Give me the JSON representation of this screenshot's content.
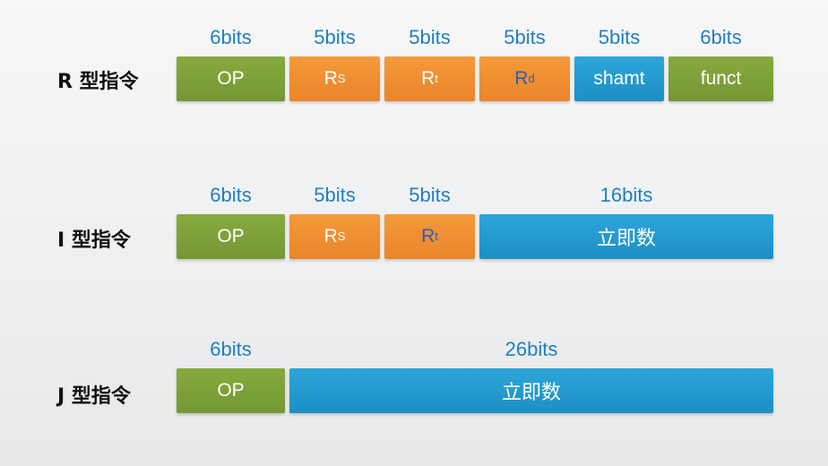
{
  "rows": [
    {
      "label": "R 型指令",
      "bits": [
        "6bits",
        "5bits",
        "5bits",
        "5bits",
        "5bits",
        "6bits"
      ],
      "fields": [
        {
          "main": "OP",
          "sub": ""
        },
        {
          "main": "R",
          "sub": "S"
        },
        {
          "main": "R",
          "sub": "t"
        },
        {
          "main": "R",
          "sub": "d"
        },
        {
          "main": "shamt",
          "sub": ""
        },
        {
          "main": "funct",
          "sub": ""
        }
      ]
    },
    {
      "label": "I 型指令",
      "bits": [
        "6bits",
        "5bits",
        "5bits",
        "16bits"
      ],
      "fields": [
        {
          "main": "OP",
          "sub": ""
        },
        {
          "main": "R",
          "sub": "S"
        },
        {
          "main": "R",
          "sub": "t"
        },
        {
          "main": "立即数",
          "sub": ""
        }
      ]
    },
    {
      "label": "J 型指令",
      "bits": [
        "6bits",
        "26bits"
      ],
      "fields": [
        {
          "main": "OP",
          "sub": ""
        },
        {
          "main": "立即数",
          "sub": ""
        }
      ]
    }
  ],
  "colors": {
    "op": "#7ea33b",
    "register": "#f0902f",
    "wide": "#2599cf",
    "bits_text": "#1f7fc2"
  }
}
